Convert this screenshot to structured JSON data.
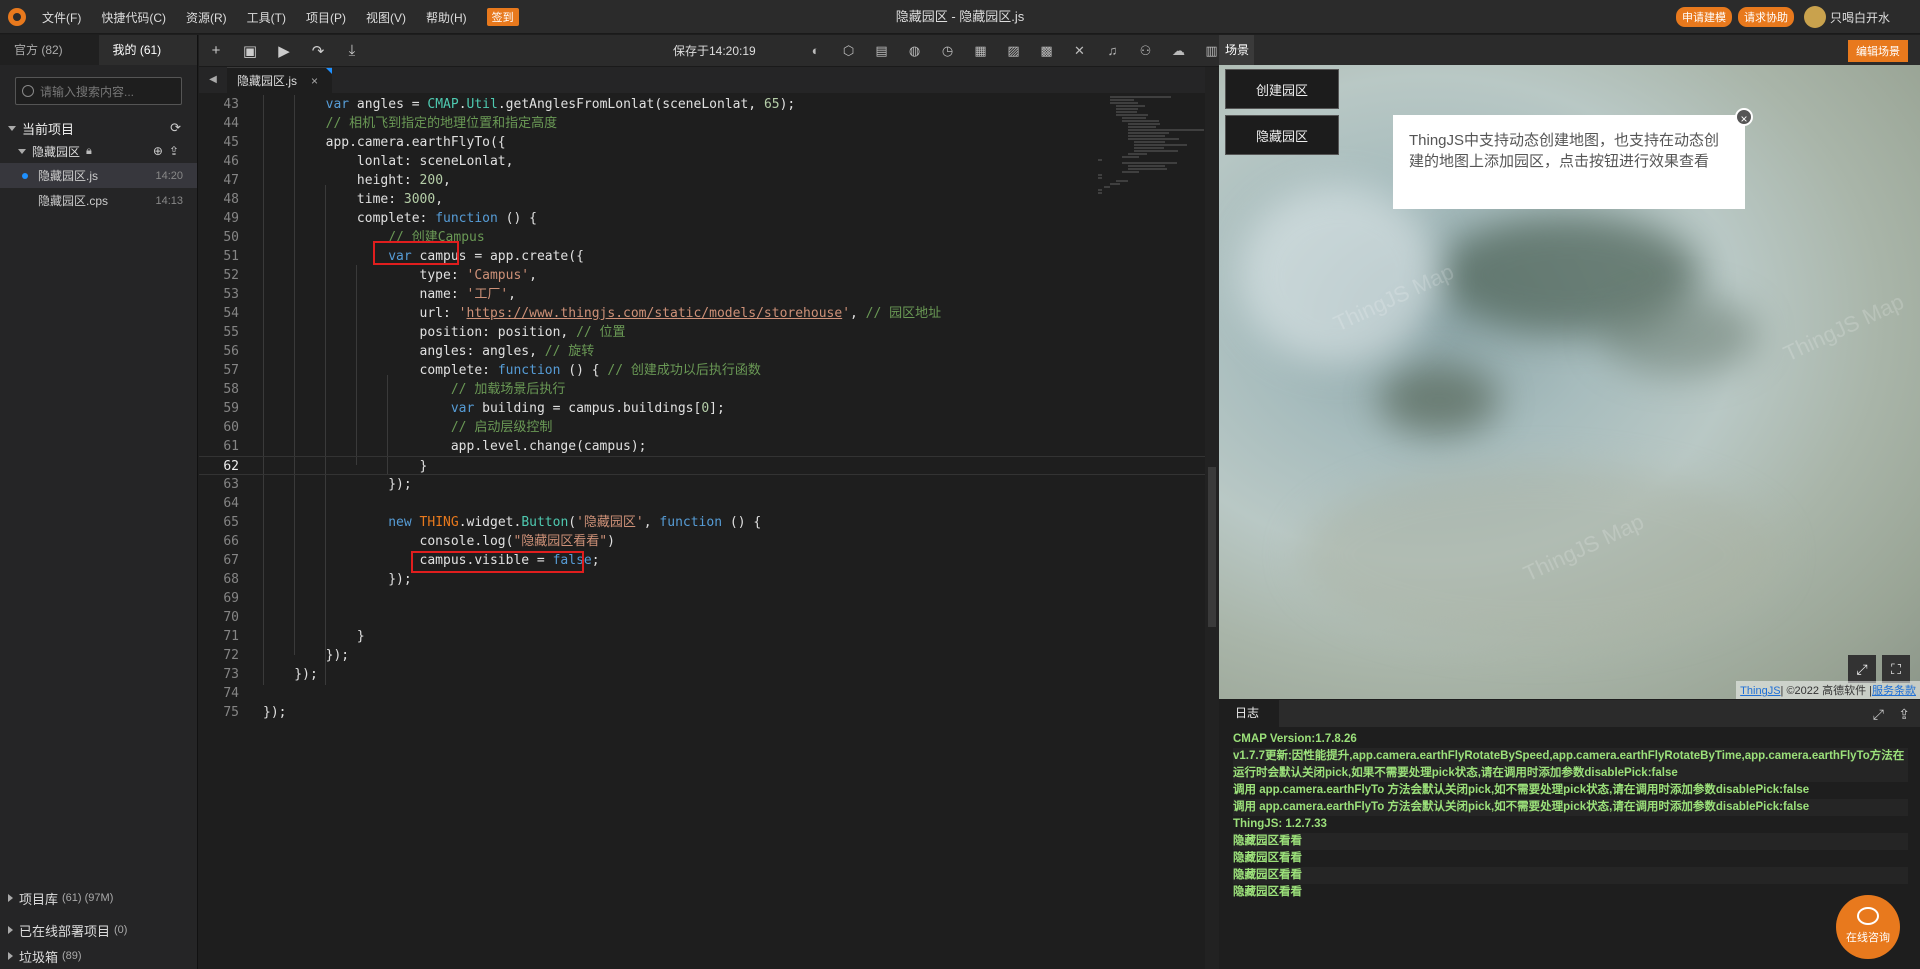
{
  "menu": {
    "items": [
      "文件(F)",
      "快捷代码(C)",
      "资源(R)",
      "工具(T)",
      "项目(P)",
      "视图(V)",
      "帮助(H)"
    ],
    "checkin": "签到"
  },
  "window_title": "隐藏园区 - 隐藏园区.js",
  "topright": {
    "btn1": "申请建模",
    "btn2": "请求协助",
    "user": "只喝白开水"
  },
  "left": {
    "tab_official": "官方 (82)",
    "tab_mine": "我的 (61)",
    "search_placeholder": "请输入搜索内容...",
    "current_project": "当前项目",
    "project_name": "隐藏园区",
    "files": [
      {
        "name": "隐藏园区.js",
        "time": "14:20"
      },
      {
        "name": "隐藏园区.cps",
        "time": "14:13"
      }
    ],
    "bottom": [
      {
        "label": "项目库",
        "count": "(61) (97M)"
      },
      {
        "label": "已在线部署项目",
        "count": "(0)"
      },
      {
        "label": "垃圾箱",
        "count": "(89)"
      }
    ]
  },
  "editor": {
    "saved": "保存于14:20:19",
    "tab": "隐藏园区.js",
    "current_line": 62
  },
  "code_lines": [
    {
      "n": 43,
      "html": "        <span class='kw'>var</span> angles = <span class='cls'>CMAP</span>.<span class='cls'>Util</span>.getAnglesFromLonlat(sceneLonlat, <span class='num'>65</span>);"
    },
    {
      "n": 44,
      "html": "        <span class='cm'>// 相机飞到指定的地理位置和指定高度</span>"
    },
    {
      "n": 45,
      "html": "        app.camera.earthFlyTo({"
    },
    {
      "n": 46,
      "html": "            lonlat: sceneLonlat,"
    },
    {
      "n": 47,
      "html": "            height: <span class='num'>200</span>,"
    },
    {
      "n": 48,
      "html": "            time: <span class='num'>3000</span>,"
    },
    {
      "n": 49,
      "html": "            complete: <span class='kw'>function</span> () {"
    },
    {
      "n": 50,
      "html": "                <span class='cm'>// 创建Campus</span>"
    },
    {
      "n": 51,
      "html": "                <span class='kw'>var</span> campus = app.create({"
    },
    {
      "n": 52,
      "html": "                    type: <span class='str'>'Campus'</span>,"
    },
    {
      "n": 53,
      "html": "                    name: <span class='str'>'工厂'</span>,"
    },
    {
      "n": 54,
      "html": "                    url: <span class='str'>'</span><span class='url'>https://www.thingjs.com/static/models/storehouse</span><span class='str'>'</span>, <span class='cm'>// 园区地址</span>"
    },
    {
      "n": 55,
      "html": "                    position: position, <span class='cm'>// 位置</span>"
    },
    {
      "n": 56,
      "html": "                    angles: angles, <span class='cm'>// 旋转</span>"
    },
    {
      "n": 57,
      "html": "                    complete: <span class='kw'>function</span> () { <span class='cm'>// 创建成功以后执行函数</span>"
    },
    {
      "n": 58,
      "html": "                        <span class='cm'>// 加载场景后执行</span>"
    },
    {
      "n": 59,
      "html": "                        <span class='kw'>var</span> building = campus.buildings[<span class='num'>0</span>];"
    },
    {
      "n": 60,
      "html": "                        <span class='cm'>// 启动层级控制</span>"
    },
    {
      "n": 61,
      "html": "                        app.level.change(campus);"
    },
    {
      "n": 62,
      "html": "                    }"
    },
    {
      "n": 63,
      "html": "                });"
    },
    {
      "n": 64,
      "html": ""
    },
    {
      "n": 65,
      "html": "                <span class='kw'>new</span> <span class='thing'>THING</span>.widget.<span class='cls'>Button</span>(<span class='str'>'隐藏园区'</span>, <span class='kw'>function</span> () {"
    },
    {
      "n": 66,
      "html": "                    console.log(<span class='str'>\"隐藏园区看看\"</span>)"
    },
    {
      "n": 67,
      "html": "                    campus.visible = <span class='kw'>false</span>;"
    },
    {
      "n": 68,
      "html": "                });"
    },
    {
      "n": 69,
      "html": ""
    },
    {
      "n": 70,
      "html": ""
    },
    {
      "n": 71,
      "html": "            }"
    },
    {
      "n": 72,
      "html": "        });"
    },
    {
      "n": 73,
      "html": "    });"
    },
    {
      "n": 74,
      "html": ""
    },
    {
      "n": 75,
      "html": "});"
    }
  ],
  "scene": {
    "tab": "场景",
    "edit": "编辑场景",
    "btn_create": "创建园区",
    "btn_hide": "隐藏园区",
    "tip": "ThingJS中支持动态创建地图，也支持在动态创建的地图上添加园区，点击按钮进行效果查看",
    "watermark": "ThingJS Map",
    "copy_thing": "ThingJS",
    "copy_text": "| ©2022 高德软件 |",
    "copy_link": "服务条款"
  },
  "log": {
    "tab": "日志",
    "lines": [
      "CMAP Version:1.7.8.26",
      "v1.7.7更新:因性能提升,app.camera.earthFlyRotateBySpeed,app.camera.earthFlyRotateByTime,app.camera.earthFlyTo方法在运行时会默认关闭pick,如果不需要处理pick状态,请在调用时添加参数disablePick:false",
      "调用 app.camera.earthFlyTo 方法会默认关闭pick,如不需要处理pick状态,请在调用时添加参数disablePick:false",
      "调用 app.camera.earthFlyTo 方法会默认关闭pick,如不需要处理pick状态,请在调用时添加参数disablePick:false",
      "ThingJS: 1.2.7.33",
      "隐藏园区看看",
      "隐藏园区看看",
      "隐藏园区看看",
      "隐藏园区看看"
    ]
  },
  "chat": "在线咨询"
}
